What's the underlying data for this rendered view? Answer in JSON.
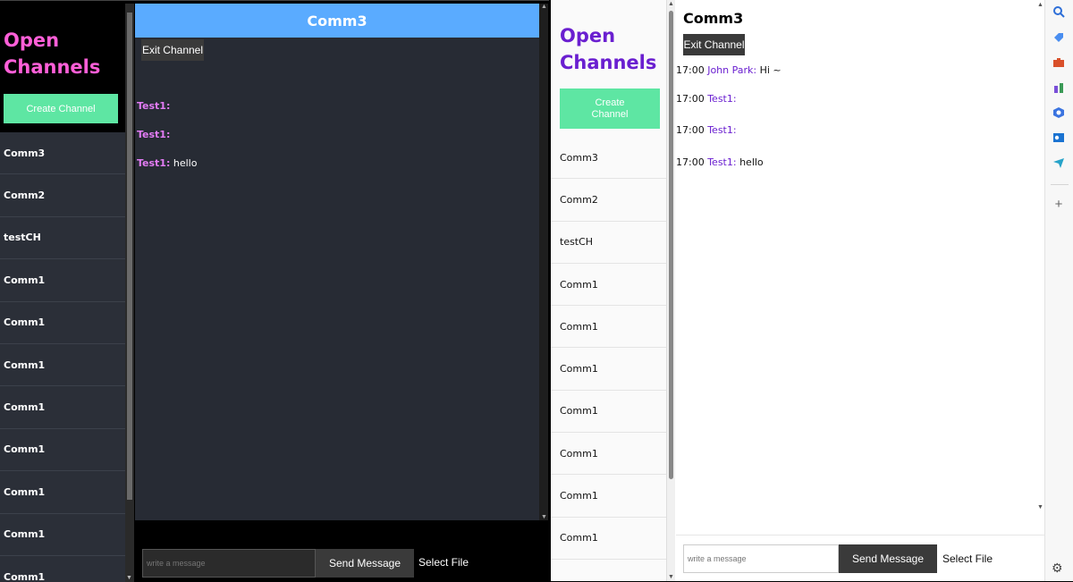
{
  "left": {
    "sidebar": {
      "title": "Open Channels",
      "create_label": "Create Channel",
      "channels": [
        "Comm3",
        "Comm2",
        "testCH",
        "Comm1",
        "Comm1",
        "Comm1",
        "Comm1",
        "Comm1",
        "Comm1",
        "Comm1",
        "Comm1"
      ]
    },
    "header": {
      "channel_name": "Comm3"
    },
    "exit_label": "Exit Channel",
    "messages": [
      {
        "user": "Test1:",
        "text": ""
      },
      {
        "user": "Test1:",
        "text": ""
      },
      {
        "user": "Test1:",
        "text": " hello"
      }
    ],
    "composer": {
      "placeholder": "write a message",
      "send_label": "Send Message",
      "file_label": "Select File"
    }
  },
  "right": {
    "sidebar": {
      "title": "Open Channels",
      "create_label": "Create Channel",
      "channels": [
        "Comm3",
        "Comm2",
        "testCH",
        "Comm1",
        "Comm1",
        "Comm1",
        "Comm1",
        "Comm1",
        "Comm1",
        "Comm1"
      ]
    },
    "header": {
      "channel_name": "Comm3"
    },
    "exit_label": "Exit Channel",
    "messages": [
      {
        "time": "17:00",
        "user": "John Park:",
        "text": " Hi ~"
      },
      {
        "time": "17:00",
        "user": "Test1:",
        "text": ""
      },
      {
        "time": "17:00",
        "user": "Test1:",
        "text": ""
      },
      {
        "time": "17:00",
        "user": "Test1:",
        "text": " hello"
      }
    ],
    "composer": {
      "placeholder": "write a message",
      "send_label": "Send Message",
      "file_label": "Select File"
    }
  },
  "edge_toolbar": {
    "icons": [
      "search-icon",
      "tag-icon",
      "briefcase-icon",
      "chess-icon",
      "office-icon",
      "outlook-icon",
      "send-icon",
      "add-icon",
      "settings-icon"
    ]
  },
  "colors": {
    "left_header": "#5aabff",
    "left_title": "#ff5fd8",
    "right_title": "#6a1fd0",
    "create_button": "#5ee6a3",
    "left_username": "#e37cf5"
  }
}
